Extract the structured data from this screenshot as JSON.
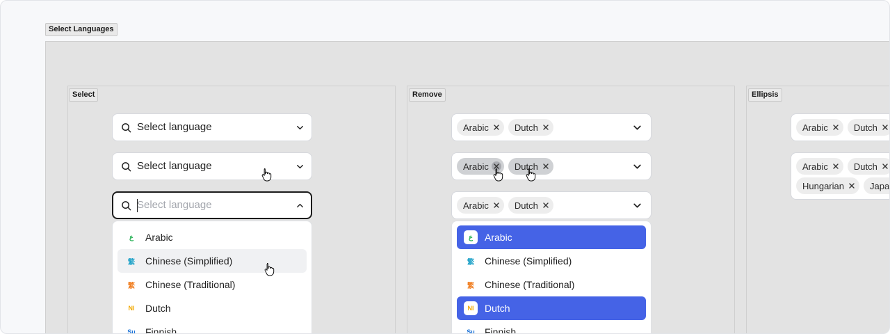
{
  "page_title": "Select Languages",
  "colors": {
    "accent": "#4563e6",
    "arabic_icon": "#2db35a",
    "chinese_icon": "#1fa2c8",
    "chinese_trad_icon": "#f07c1d",
    "dutch_icon": "#f2a900",
    "finnish_icon": "#1b72d8"
  },
  "sections": {
    "select": {
      "label": "Select",
      "fields": [
        {
          "placeholder": "Select language"
        },
        {
          "placeholder": "Select language"
        },
        {
          "placeholder": "Select language"
        }
      ],
      "options": [
        {
          "label": "Arabic",
          "icon": "arabic-letter-icon",
          "glyph": "ع"
        },
        {
          "label": "Chinese (Simplified)",
          "icon": "chinese-character-icon",
          "glyph": "繁"
        },
        {
          "label": "Chinese (Traditional)",
          "icon": "chinese-character-icon",
          "glyph": "繁"
        },
        {
          "label": "Dutch",
          "icon": "dutch-nl-icon",
          "glyph": "Nl"
        },
        {
          "label": "Finnish",
          "icon": "finnish-su-icon",
          "glyph": "Su"
        }
      ]
    },
    "remove": {
      "label": "Remove",
      "chips": [
        "Arabic",
        "Dutch"
      ],
      "options": [
        {
          "label": "Arabic",
          "icon": "arabic-letter-icon",
          "glyph": "ع",
          "selected": true
        },
        {
          "label": "Chinese (Simplified)",
          "icon": "chinese-character-icon",
          "glyph": "繁",
          "selected": false
        },
        {
          "label": "Chinese (Traditional)",
          "icon": "chinese-character-icon",
          "glyph": "繁",
          "selected": false
        },
        {
          "label": "Dutch",
          "icon": "dutch-nl-icon",
          "glyph": "Nl",
          "selected": true
        },
        {
          "label": "Finnish",
          "icon": "finnish-su-icon",
          "glyph": "Su",
          "selected": false
        }
      ]
    },
    "ellipsis": {
      "label": "Ellipsis",
      "row1": [
        "Arabic",
        "Dutch"
      ],
      "row2": [
        "Arabic",
        "Dutch"
      ],
      "row3": [
        "Hungarian",
        "Japan"
      ]
    }
  }
}
